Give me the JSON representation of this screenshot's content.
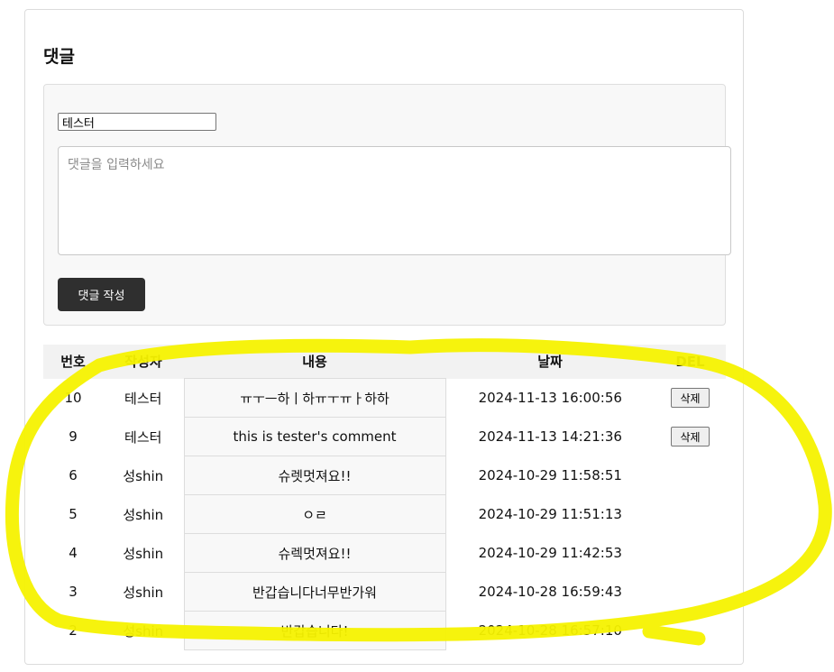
{
  "section": {
    "title": "댓글"
  },
  "form": {
    "author_value": "테스터",
    "comment_placeholder": "댓글을 입력하세요",
    "submit_label": "댓글 작성"
  },
  "table": {
    "headers": [
      "번호",
      "작성자",
      "내용",
      "날짜",
      "DEL"
    ],
    "rows": [
      {
        "no": "10",
        "author": "테스터",
        "content": "ㅠㅜㅡ하ㅣ하ㅠㅜㅠㅏ하하",
        "date": "2024-11-13 16:00:56",
        "del": "삭제"
      },
      {
        "no": "9",
        "author": "테스터",
        "content": "this is tester's comment",
        "date": "2024-11-13 14:21:36",
        "del": "삭제"
      },
      {
        "no": "6",
        "author": "성shin",
        "content": "슈렛멋져요!!",
        "date": "2024-10-29 11:58:51"
      },
      {
        "no": "5",
        "author": "성shin",
        "content": "ㅇㄹ",
        "date": "2024-10-29 11:51:13"
      },
      {
        "no": "4",
        "author": "성shin",
        "content": "슈렉멋져요!!",
        "date": "2024-10-29 11:42:53"
      },
      {
        "no": "3",
        "author": "성shin",
        "content": "반갑습니다너무반가워",
        "date": "2024-10-28 16:59:43"
      },
      {
        "no": "2",
        "author": "성shin",
        "content": "반갑습니다!",
        "date": "2024-10-28 16:57:10"
      }
    ]
  },
  "annotation": {
    "color": "#f5f200"
  }
}
